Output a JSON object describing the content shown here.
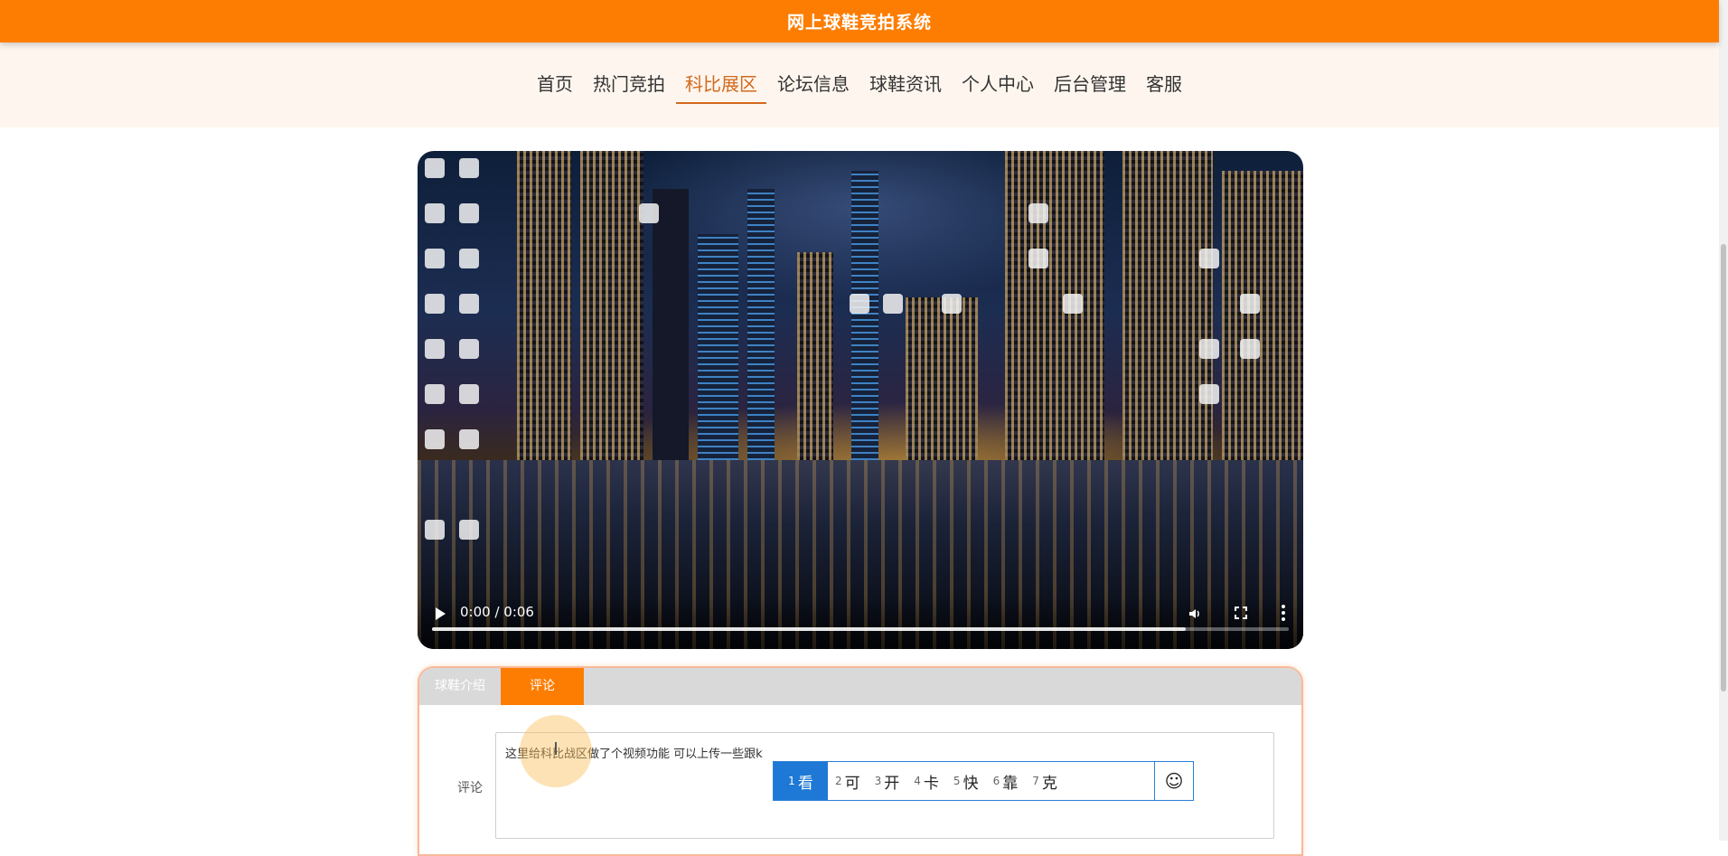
{
  "header": {
    "title": "网上球鞋竞拍系统"
  },
  "nav": {
    "items": [
      {
        "label": "首页"
      },
      {
        "label": "热门竞拍"
      },
      {
        "label": "科比展区",
        "active": true
      },
      {
        "label": "论坛信息"
      },
      {
        "label": "球鞋资讯"
      },
      {
        "label": "个人中心"
      },
      {
        "label": "后台管理"
      },
      {
        "label": "客服"
      }
    ]
  },
  "video": {
    "time": "0:00 / 0:06",
    "progress": 0.88
  },
  "tabs": {
    "items": [
      {
        "label": "球鞋介绍"
      },
      {
        "label": "评论",
        "active": true
      }
    ]
  },
  "comment": {
    "label": "评论",
    "value": "这里给科比战区做了个视频功能  可以上传一些跟k"
  },
  "ime": {
    "candidates": [
      {
        "num": "1",
        "char": "看"
      },
      {
        "num": "2",
        "char": "可"
      },
      {
        "num": "3",
        "char": "开"
      },
      {
        "num": "4",
        "char": "卡"
      },
      {
        "num": "5",
        "char": "快"
      },
      {
        "num": "6",
        "char": "靠"
      },
      {
        "num": "7",
        "char": "克"
      }
    ],
    "emoji": "☺"
  },
  "colors": {
    "brand": "#fd7d02",
    "navActive": "#d2691e",
    "imeSelect": "#1e78d6"
  }
}
